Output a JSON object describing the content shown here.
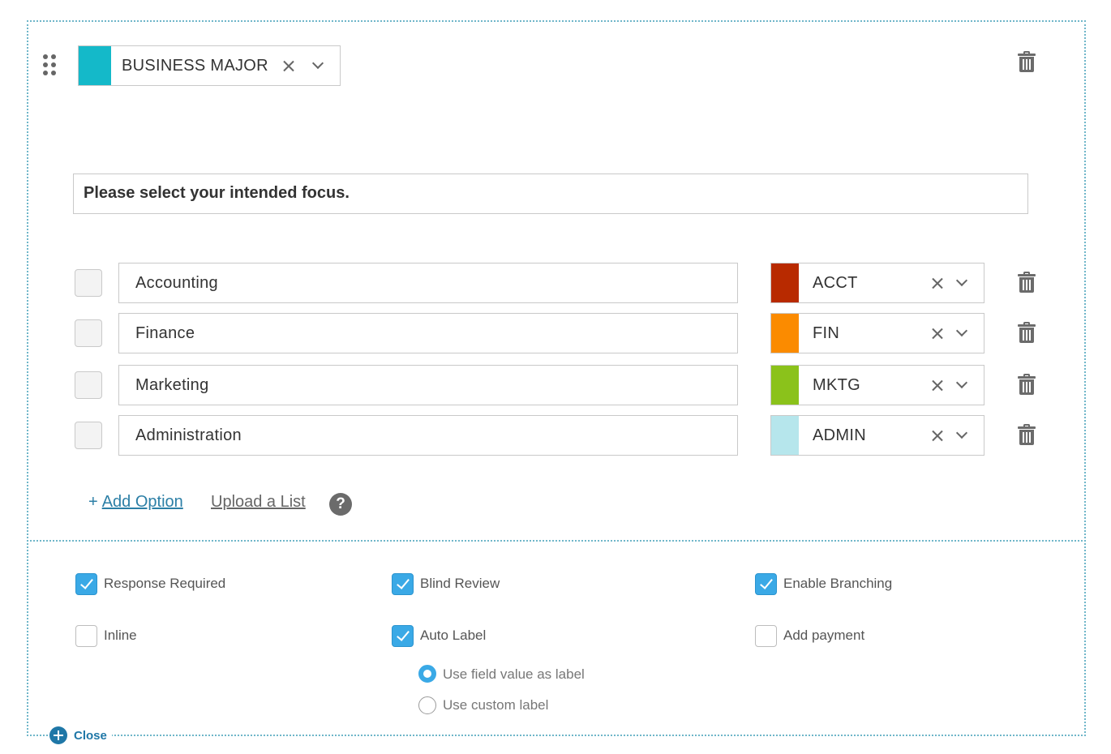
{
  "field": {
    "category_label": "BUSINESS MAJOR",
    "category_color": "#14b9c9",
    "question": "Please select your intended focus."
  },
  "options": [
    {
      "text": "Accounting",
      "tag": "ACCT",
      "color": "#b82a00"
    },
    {
      "text": "Finance",
      "tag": "FIN",
      "color": "#fb8b00"
    },
    {
      "text": "Marketing",
      "tag": "MKTG",
      "color": "#8bc21b"
    },
    {
      "text": "Administration",
      "tag": "ADMIN",
      "color": "#b6e6ec"
    }
  ],
  "actions": {
    "add_option_plus": "+",
    "add_option": "Add Option",
    "upload_list": "Upload a List",
    "help_glyph": "?"
  },
  "settings": {
    "response_required": {
      "label": "Response Required",
      "checked": true
    },
    "blind_review": {
      "label": "Blind Review",
      "checked": true
    },
    "enable_branching": {
      "label": "Enable Branching",
      "checked": true
    },
    "inline": {
      "label": "Inline",
      "checked": false
    },
    "auto_label": {
      "label": "Auto Label",
      "checked": true
    },
    "add_payment": {
      "label": "Add payment",
      "checked": false
    },
    "label_mode": {
      "field_value": "Use field value as label",
      "custom": "Use custom label",
      "selected": "field_value"
    }
  },
  "footer": {
    "close_label": "Close"
  },
  "icons": {
    "drag": "drag-handle-icon",
    "delete": "trash-icon",
    "clear": "close-icon",
    "expand": "chevron-down-icon",
    "help": "help-icon",
    "close": "plus-circle-icon"
  }
}
